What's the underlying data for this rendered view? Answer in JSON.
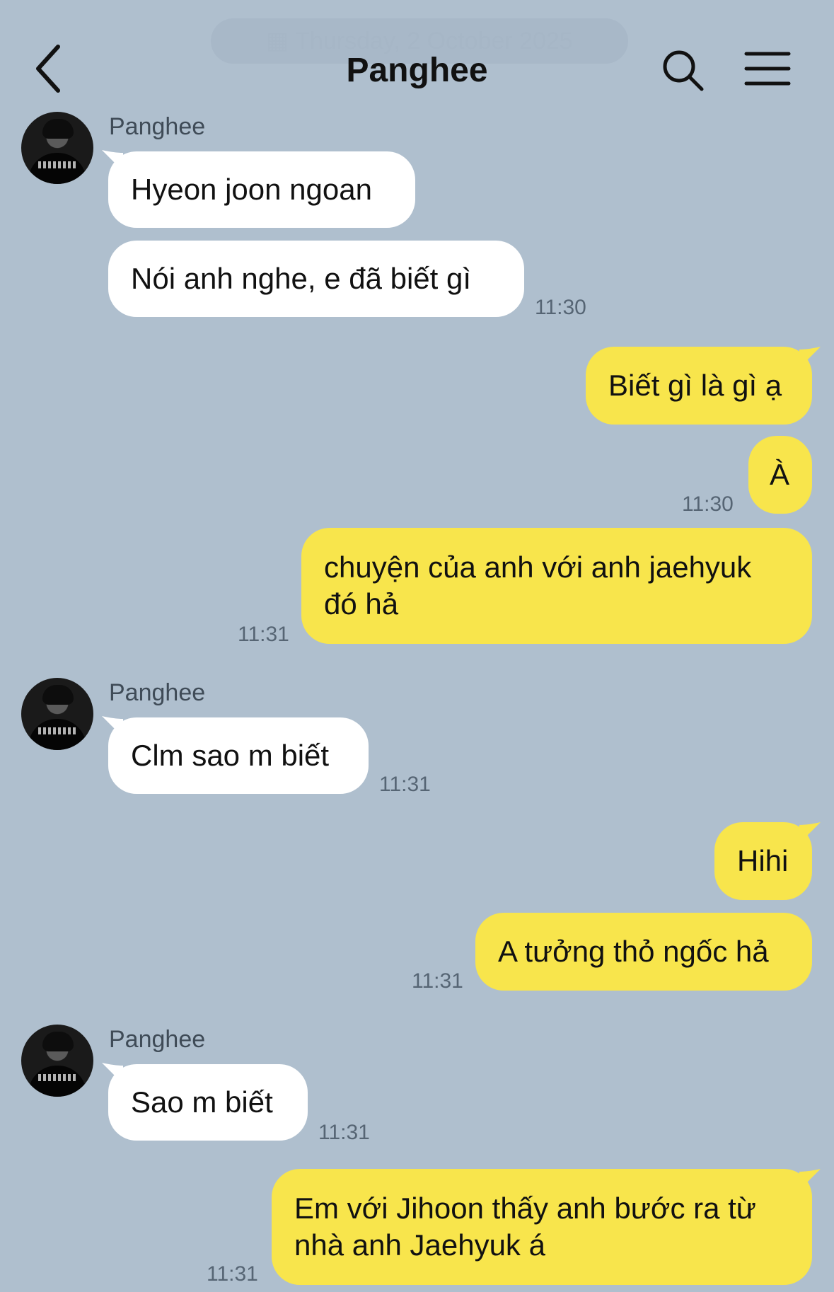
{
  "date_banner": "Thursday, 2 October 2025",
  "header": {
    "title": "Panghee",
    "back_icon": "chevron-left-icon",
    "search_icon": "search-icon",
    "menu_icon": "hamburger-menu-icon"
  },
  "colors": {
    "background": "#afbfce",
    "incoming_bubble": "#ffffff",
    "outgoing_bubble": "#f8e54c"
  },
  "messages": [
    {
      "sender": "Panghee",
      "text": "Hyeon joon ngoan"
    },
    {
      "text": "Nói anh nghe, e đã biết gì",
      "time": "11:30"
    },
    {
      "text": "Biết gì là gì ạ"
    },
    {
      "text": "À",
      "time": "11:30"
    },
    {
      "text": "chuyện của anh với anh jaehyuk đó hả",
      "time": "11:31"
    },
    {
      "sender": "Panghee",
      "text": "Clm sao m biết",
      "time": "11:31"
    },
    {
      "text": "Hihi"
    },
    {
      "text": "A tưởng thỏ ngốc hả",
      "time": "11:31"
    },
    {
      "sender": "Panghee",
      "text": "Sao m biết",
      "time": "11:31"
    },
    {
      "text": "Em với Jihoon thấy anh bước ra từ nhà anh Jaehyuk á",
      "time": "11:31"
    }
  ]
}
